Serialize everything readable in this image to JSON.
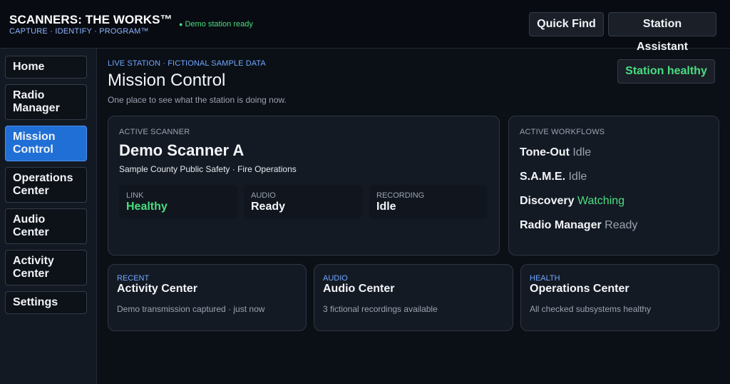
{
  "header": {
    "title": "SCANNERS: THE WORKS™",
    "subtitle": "CAPTURE · IDENTIFY · PROGRAM™",
    "status": "Demo station ready",
    "status_dot": "●",
    "quick_find": "Quick Find",
    "station_assistant": "Station Assistant"
  },
  "sidebar": {
    "items": [
      {
        "label": "Home"
      },
      {
        "label": "Radio Manager"
      },
      {
        "label": "Mission Control"
      },
      {
        "label": "Operations Center"
      },
      {
        "label": "Audio Center"
      },
      {
        "label": "Activity Center"
      },
      {
        "label": "Settings"
      }
    ],
    "active": "Mission Control"
  },
  "page": {
    "eyebrow": "LIVE STATION · FICTIONAL SAMPLE DATA",
    "title": "Mission Control",
    "subtitle": "One place to see what the station is doing now.",
    "health_badge": "Station healthy"
  },
  "scanner": {
    "label": "ACTIVE SCANNER",
    "name": "Demo Scanner A",
    "description": "Sample County Public Safety · Fire Operations",
    "stats": [
      {
        "label": "LINK",
        "value": "Healthy"
      },
      {
        "label": "AUDIO",
        "value": "Ready"
      },
      {
        "label": "RECORDING",
        "value": "Idle"
      }
    ]
  },
  "workflows": {
    "label": "ACTIVE WORKFLOWS",
    "items": [
      {
        "name": "Tone-Out",
        "state": "Idle"
      },
      {
        "name": "S.A.M.E.",
        "state": "Idle"
      },
      {
        "name": "Discovery",
        "state": "Watching"
      },
      {
        "name": "Radio Manager",
        "state": "Ready"
      }
    ]
  },
  "summary_cards": [
    {
      "eyebrow": "RECENT",
      "title": "Activity Center",
      "text": "Demo transmission captured · just now"
    },
    {
      "eyebrow": "AUDIO",
      "title": "Audio Center",
      "text": "3 fictional recordings available"
    },
    {
      "eyebrow": "HEALTH",
      "title": "Operations Center",
      "text": "All checked subsystems healthy"
    }
  ],
  "colors": {
    "accent": "#1f6fd6",
    "good": "#4ade80",
    "eyebrow": "#6fa8ff",
    "background": "#0b0f16"
  }
}
